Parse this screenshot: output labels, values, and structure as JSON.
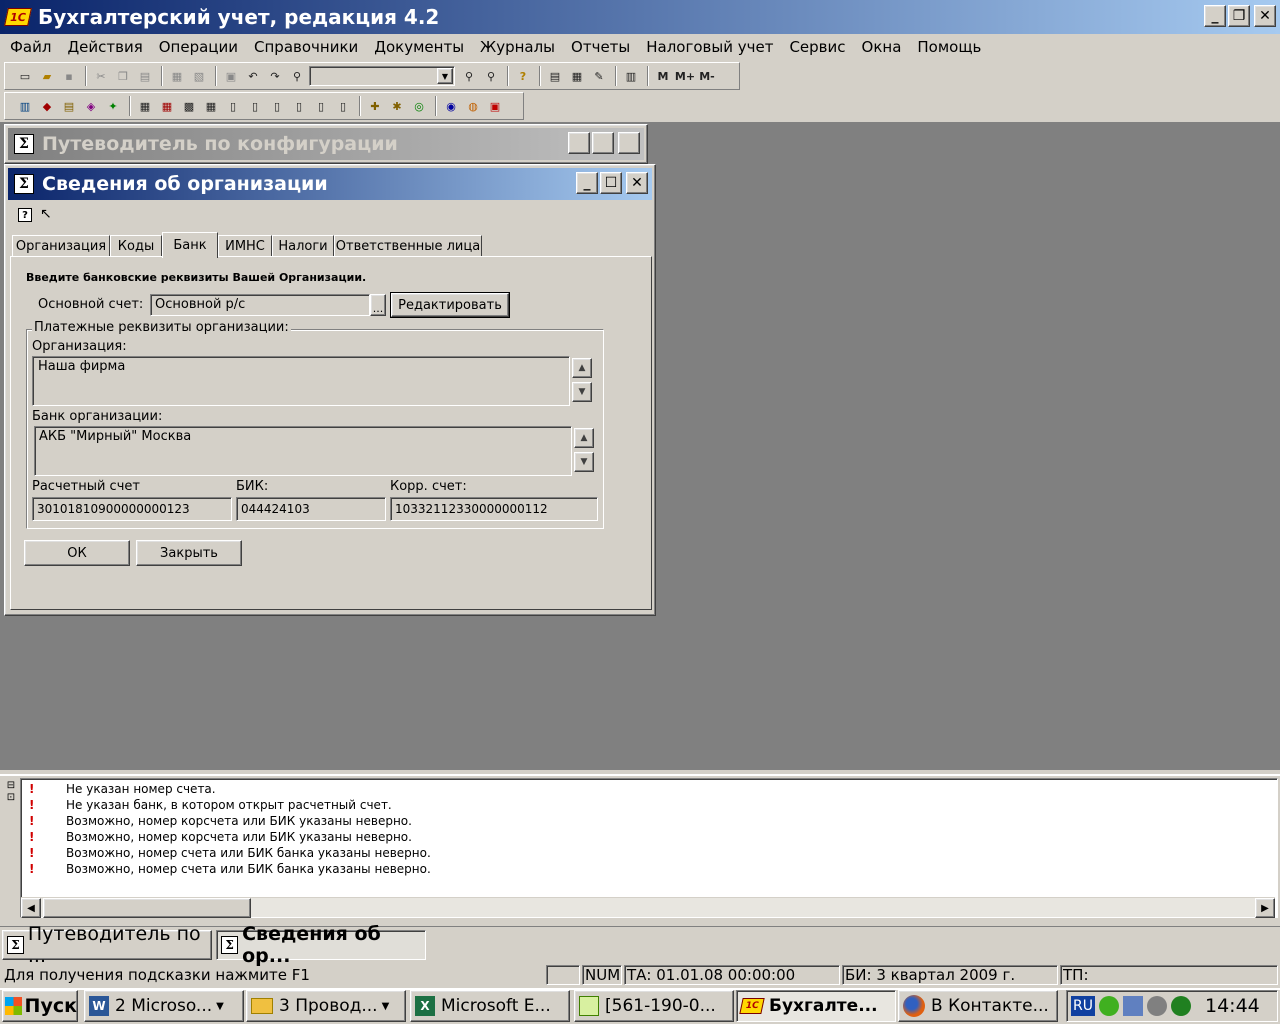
{
  "app": {
    "title": "Бухгалтерский учет, редакция 4.2",
    "icon": "1c-app-icon"
  },
  "menu": [
    "Файл",
    "Действия",
    "Операции",
    "Справочники",
    "Документы",
    "Журналы",
    "Отчеты",
    "Налоговый учет",
    "Сервис",
    "Окна",
    "Помощь"
  ],
  "toolbar": {
    "memory_buttons": [
      "M",
      "M+",
      "M-"
    ],
    "search_value": ""
  },
  "guide_window": {
    "title": "Путеводитель по конфигурации"
  },
  "org_window": {
    "title": "Сведения об организации",
    "tabs": [
      "Организация",
      "Коды",
      "Банк",
      "ИМНС",
      "Налоги",
      "Ответственные лица"
    ],
    "active_tab": "Банк",
    "instruction": "Введите банковские реквизиты Вашей Организации.",
    "main_account_label": "Основной счет:",
    "main_account_value": "Основной р/с",
    "select_button": "...",
    "edit_button": "Редактировать",
    "group_title": "Платежные реквизиты организации:",
    "org_label": "Организация:",
    "org_value": "Наша фирма",
    "bank_label": "Банк организации:",
    "bank_value": "АКБ \"Мирный\" Москва",
    "account_label": "Расчетный счет",
    "account_value": "30101810900000000123",
    "bik_label": "БИК:",
    "bik_value": "044424103",
    "corr_label": "Корр. счет:",
    "corr_value": "10332112330000000112",
    "ok_button": "ОК",
    "close_button": "Закрыть"
  },
  "messages": [
    "Не указан номер счета.",
    "Не указан банк, в котором открыт расчетный счет.",
    "Возможно, номер корсчета или БИК указаны неверно.",
    "Возможно, номер корсчета или БИК указаны неверно.",
    "Возможно, номер счета или БИК банка указаны неверно.",
    "Возможно, номер счета или БИК банка указаны неверно."
  ],
  "window_tabs": [
    "Путеводитель по ...",
    "Сведения об ор..."
  ],
  "status": {
    "hint": "Для получения подсказки нажмите F1",
    "num": "NUM",
    "ta": "ТА: 01.01.08  00:00:00",
    "bi": "БИ: 3 квартал 2009 г.",
    "tp": "ТП:"
  },
  "taskbar": {
    "start": "Пуск",
    "items": [
      "2 Microso...",
      "3 Провод...",
      "Microsoft E...",
      "[561-190-0...",
      "Бухгалте...",
      "В Контакте..."
    ],
    "lang": "RU",
    "clock": "14:44"
  }
}
